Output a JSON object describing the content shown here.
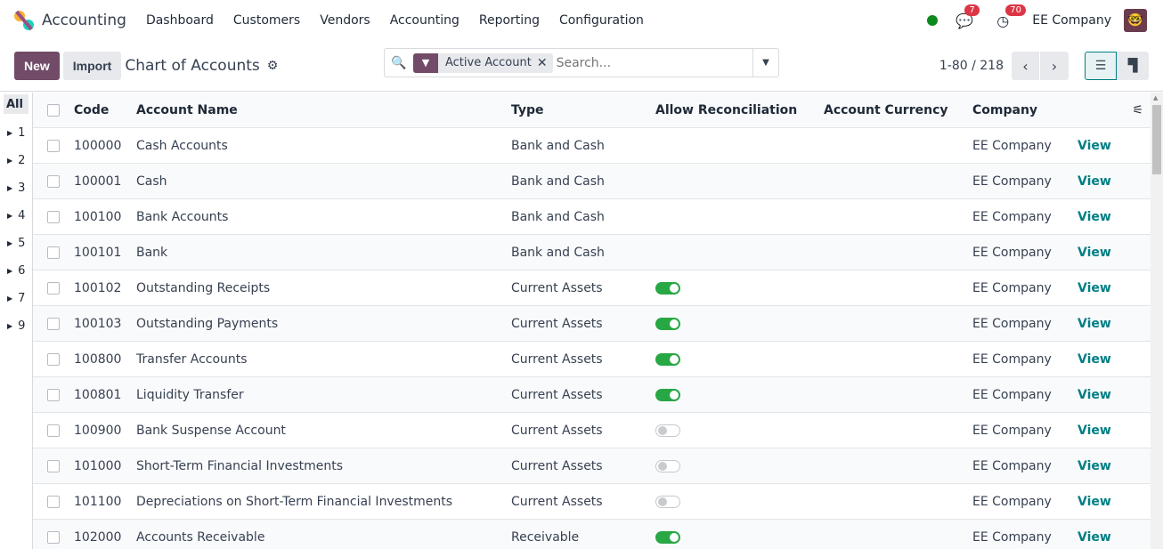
{
  "nav": {
    "app": "Accounting",
    "menu": [
      "Dashboard",
      "Customers",
      "Vendors",
      "Accounting",
      "Reporting",
      "Configuration"
    ],
    "messages_count": "7",
    "activities_count": "70",
    "company": "EE Company"
  },
  "control": {
    "new": "New",
    "import": "Import",
    "title": "Chart of Accounts",
    "facet": "Active Account",
    "search_placeholder": "Search...",
    "pager": "1-80 / 218"
  },
  "sidebar": {
    "all": "All",
    "groups": [
      "1",
      "2",
      "3",
      "4",
      "5",
      "6",
      "7",
      "9"
    ]
  },
  "columns": {
    "code": "Code",
    "name": "Account Name",
    "type": "Type",
    "reconcile": "Allow Reconciliation",
    "currency": "Account Currency",
    "company": "Company"
  },
  "colors": {
    "primary": "#714b67",
    "link": "#017e84",
    "toggle_on": "#28a745"
  },
  "rows": [
    {
      "code": "100000",
      "name": "Cash Accounts",
      "type": "Bank and Cash",
      "reconcile": null,
      "company": "EE Company",
      "view": "View"
    },
    {
      "code": "100001",
      "name": "Cash",
      "type": "Bank and Cash",
      "reconcile": null,
      "company": "EE Company",
      "view": "View"
    },
    {
      "code": "100100",
      "name": "Bank Accounts",
      "type": "Bank and Cash",
      "reconcile": null,
      "company": "EE Company",
      "view": "View"
    },
    {
      "code": "100101",
      "name": "Bank",
      "type": "Bank and Cash",
      "reconcile": null,
      "company": "EE Company",
      "view": "View"
    },
    {
      "code": "100102",
      "name": "Outstanding Receipts",
      "type": "Current Assets",
      "reconcile": true,
      "company": "EE Company",
      "view": "View"
    },
    {
      "code": "100103",
      "name": "Outstanding Payments",
      "type": "Current Assets",
      "reconcile": true,
      "company": "EE Company",
      "view": "View"
    },
    {
      "code": "100800",
      "name": "Transfer Accounts",
      "type": "Current Assets",
      "reconcile": true,
      "company": "EE Company",
      "view": "View"
    },
    {
      "code": "100801",
      "name": "Liquidity Transfer",
      "type": "Current Assets",
      "reconcile": true,
      "company": "EE Company",
      "view": "View"
    },
    {
      "code": "100900",
      "name": "Bank Suspense Account",
      "type": "Current Assets",
      "reconcile": false,
      "company": "EE Company",
      "view": "View"
    },
    {
      "code": "101000",
      "name": "Short-Term Financial Investments",
      "type": "Current Assets",
      "reconcile": false,
      "company": "EE Company",
      "view": "View"
    },
    {
      "code": "101100",
      "name": "Depreciations on Short-Term Financial Investments",
      "type": "Current Assets",
      "reconcile": false,
      "company": "EE Company",
      "view": "View"
    },
    {
      "code": "102000",
      "name": "Accounts Receivable",
      "type": "Receivable",
      "reconcile": true,
      "company": "EE Company",
      "view": "View"
    }
  ]
}
